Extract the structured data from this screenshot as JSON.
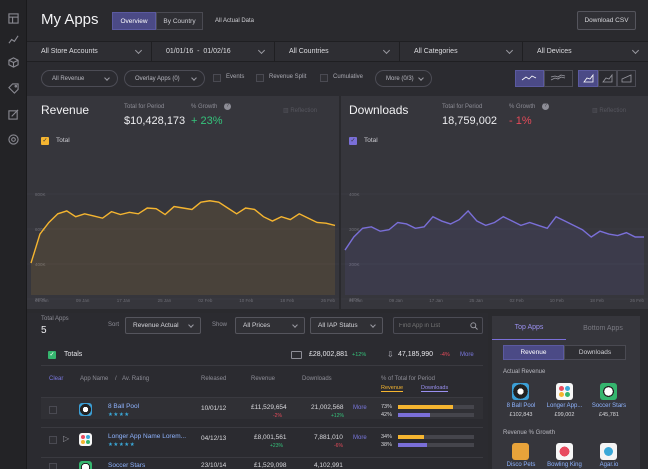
{
  "page_title": "My Apps",
  "view_tabs": [
    "Overview",
    "By Country"
  ],
  "data_note": "All Actual Data",
  "download_csv": "Download CSV",
  "filters": {
    "store_accounts": "All Store Accounts",
    "date_range": "01/01/16  -  01/02/16",
    "countries": "All Countries",
    "categories": "All Categories",
    "devices": "All Devices"
  },
  "options": {
    "revenue_dd": "All Revenue",
    "overlay_dd": "Overlay Apps (0)",
    "events": "Events",
    "revenue_split": "Revenue Split",
    "cumulative": "Cumulative",
    "more_dd": "More (0/3)"
  },
  "revenue_panel": {
    "title": "Revenue",
    "total_label": "Total for Period",
    "total_value": "$10,428,173",
    "growth_label": "% Growth",
    "growth_value": "+ 23%",
    "reflection": "Reflection",
    "legend": "Total",
    "yticks": [
      "800K",
      "600K",
      "400K",
      "200K"
    ],
    "color": "#f5b530"
  },
  "downloads_panel": {
    "title": "Downloads",
    "total_label": "Total for Period",
    "total_value": "18,759,002",
    "growth_label": "% Growth",
    "growth_value": "- 1%",
    "reflection": "Reflection",
    "legend": "Total",
    "yticks": [
      "400K",
      "300K",
      "200K",
      "100K"
    ],
    "color": "#7a6fd8"
  },
  "xticks": [
    "01 Jan",
    "09 Jan",
    "17 Jan",
    "25 Jan",
    "02 Feb",
    "10 Feb",
    "18 Feb",
    "26 Feb"
  ],
  "chart_data": [
    {
      "type": "area",
      "title": "Revenue",
      "series": [
        {
          "name": "Total",
          "values": [
            220,
            420,
            500,
            560,
            580,
            540,
            560,
            545,
            530,
            575,
            555,
            570,
            560,
            600,
            595,
            555,
            610,
            600,
            590,
            640,
            650,
            640,
            600,
            560,
            600,
            590,
            540,
            510,
            540,
            520,
            560,
            530,
            500,
            495,
            480
          ]
        }
      ],
      "ylim": [
        0,
        1000
      ]
    },
    {
      "type": "area",
      "title": "Downloads",
      "series": [
        {
          "name": "Total",
          "values": [
            155,
            200,
            230,
            235,
            220,
            225,
            250,
            245,
            230,
            235,
            270,
            255,
            245,
            260,
            290,
            255,
            240,
            250,
            270,
            255,
            240,
            250,
            240,
            230,
            270,
            255,
            240,
            225,
            200,
            220,
            210,
            205,
            215,
            200,
            200
          ]
        }
      ],
      "ylim": [
        0,
        500
      ]
    }
  ],
  "summary": {
    "total_apps_label": "Total Apps",
    "total_apps": "5",
    "sort_label": "Sort",
    "sort_value": "Revenue Actual",
    "show_label": "Show",
    "price_value": "All Prices",
    "iap_value": "All IAP Status",
    "search_placeholder": "Find App in List"
  },
  "totals": {
    "label": "Totals",
    "revenue": "£28,002,881",
    "revenue_growth": "+12%",
    "downloads": "47,185,990",
    "downloads_growth": "-4%",
    "more": "More"
  },
  "table": {
    "clear": "Clear",
    "headers": [
      "App Name",
      "/",
      "Av. Rating",
      "Released",
      "Revenue",
      "Downloads",
      "% of Total for Period"
    ],
    "sub_headers": [
      "Revenue",
      "Downloads"
    ],
    "rows": [
      {
        "name": "8 Ball Pool",
        "stars": "★★★★",
        "released": "10/01/12",
        "revenue": "£11,529,654",
        "rev_growth": "-2%",
        "downloads": "21,002,568",
        "dl_growth": "+12%",
        "more": "More",
        "rev_pct": "73%",
        "dl_pct": "42%",
        "rev_frac": 0.73,
        "dl_frac": 0.42,
        "icon": "8-ball-icon"
      },
      {
        "name": "Longer App Name Lorem...",
        "stars": "★★★★★",
        "released": "04/12/13",
        "revenue": "£8,001,561",
        "rev_growth": "+23%",
        "downloads": "7,881,010",
        "dl_growth": "-6%",
        "more": "More",
        "rev_pct": "34%",
        "dl_pct": "38%",
        "rev_frac": 0.34,
        "dl_frac": 0.38,
        "icon": "dots-app-icon"
      },
      {
        "name": "Soccer Stars",
        "stars": "",
        "released": "23/10/14",
        "revenue": "£1,529,098",
        "rev_growth": "",
        "downloads": "4,102,991",
        "dl_growth": "",
        "more": "",
        "rev_pct": "",
        "dl_pct": "",
        "rev_frac": 0,
        "dl_frac": 0,
        "icon": "soccer-icon"
      }
    ]
  },
  "right_panel": {
    "tabs": [
      "Top Apps",
      "Bottom Apps"
    ],
    "toggle": [
      "Revenue",
      "Downloads"
    ],
    "actual_revenue": "Actual Revenue",
    "top_actual": [
      {
        "name": "8 Ball Pool",
        "value": "£102,843"
      },
      {
        "name": "Longer App...",
        "value": "£99,002"
      },
      {
        "name": "Soccer Stars",
        "value": "£45,781"
      }
    ],
    "growth_label": "Revenue % Growth",
    "top_growth": [
      {
        "name": "Disco Pets"
      },
      {
        "name": "Bowling King"
      },
      {
        "name": "Agar.io"
      }
    ]
  }
}
